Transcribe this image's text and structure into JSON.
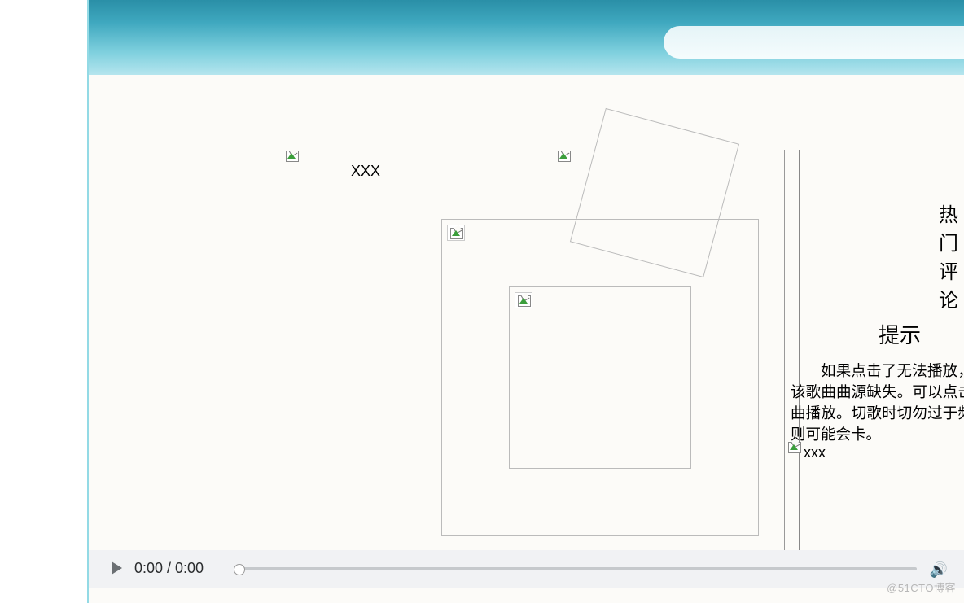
{
  "header": {
    "search_placeholder": ""
  },
  "thumbs": {
    "item1_label": "XXX",
    "item3_label": "xxx"
  },
  "sidebar": {
    "hot_comments_title": "热门评论",
    "tip_title": "提示",
    "tip_body": "如果点击了无法播放，可能是该歌曲曲源缺失。可以点击其它歌曲播放。切歌时切勿过于频繁，否则可能会卡。"
  },
  "player": {
    "time_display": "0:00 / 0:00"
  },
  "watermark": "@51CTO博客"
}
